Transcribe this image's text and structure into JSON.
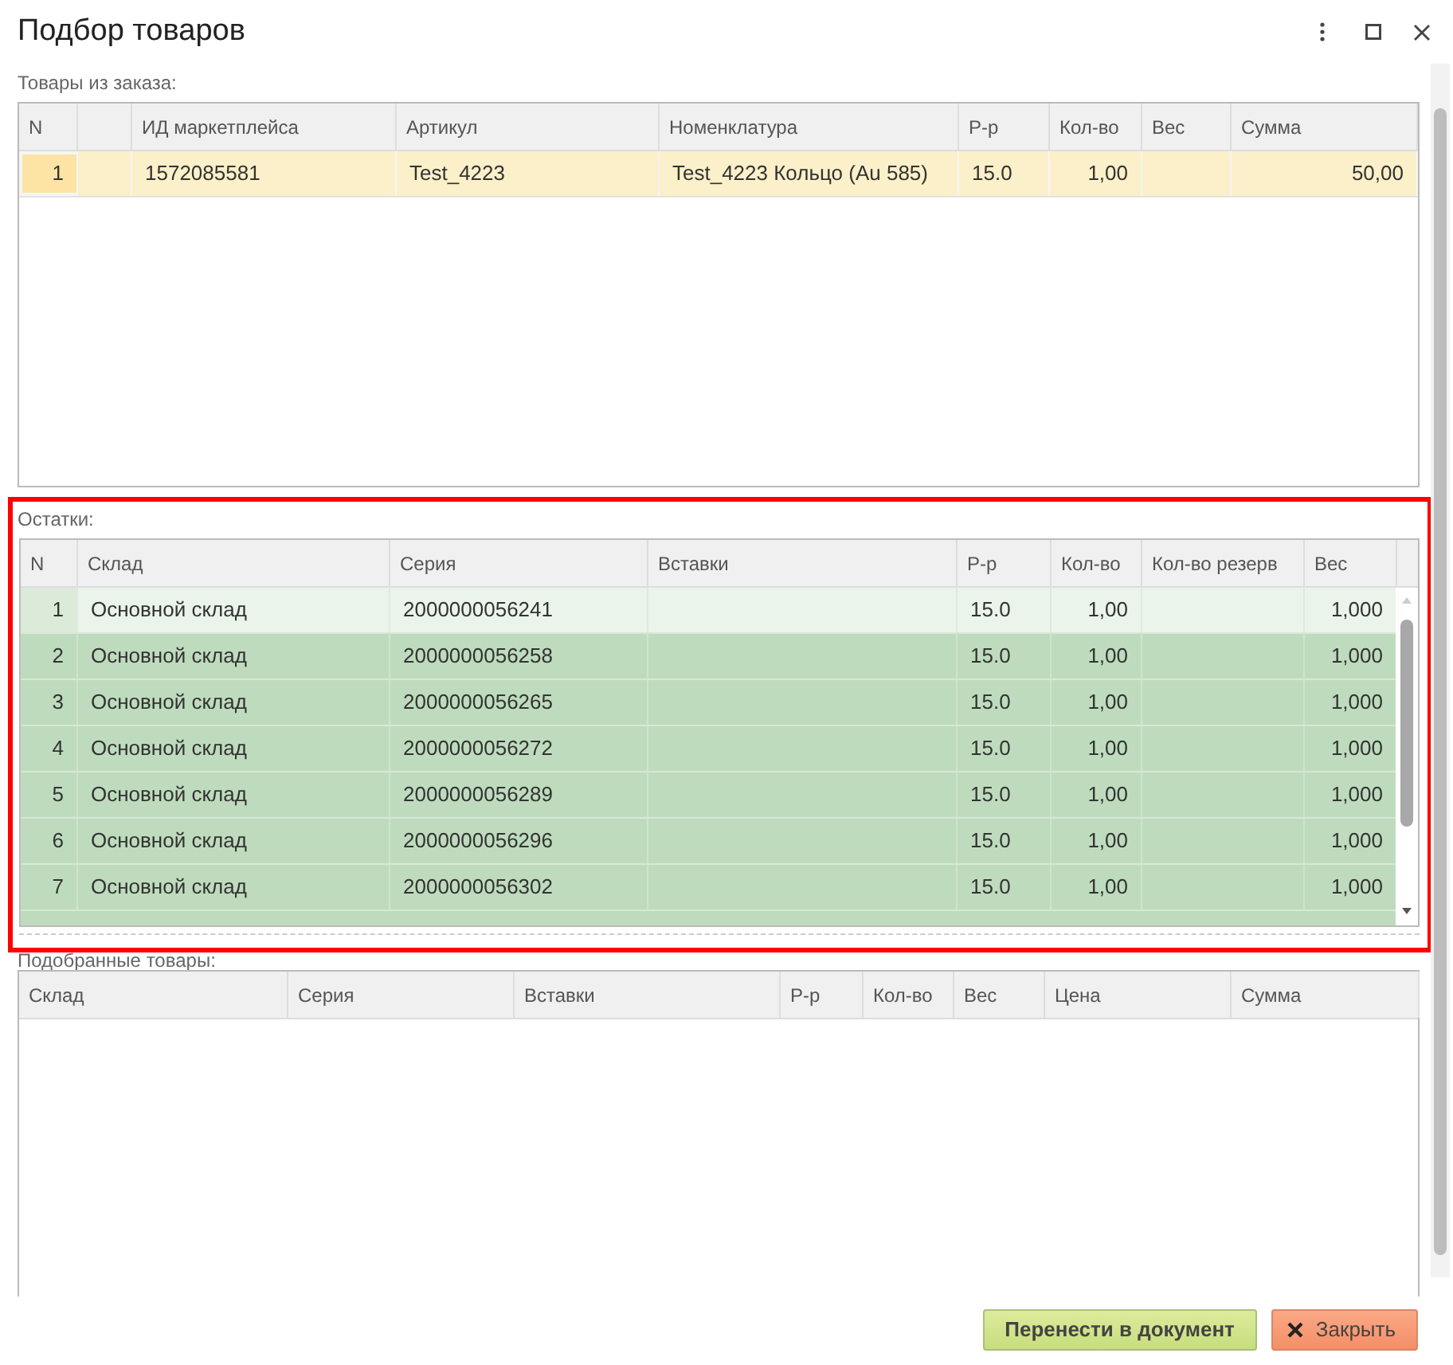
{
  "window": {
    "title": "Подбор товаров"
  },
  "order_items": {
    "label": "Товары из заказа:",
    "columns": [
      "N",
      "",
      "ИД маркетплейса",
      "Артикул",
      "Номенклатура",
      "Р-р",
      "Кол-во",
      "Вес",
      "Сумма"
    ],
    "rows": [
      {
        "selected": true,
        "cells": [
          "1",
          "",
          "1572085581",
          "Test_4223",
          "Test_4223 Кольцо (Au 585)",
          "15.0",
          "1,00",
          "",
          "50,00"
        ]
      }
    ]
  },
  "stock": {
    "label": "Остатки:",
    "columns": [
      "N",
      "Склад",
      "Серия",
      "Вставки",
      "Р-р",
      "Кол-во",
      "Кол-во резерв",
      "Вес"
    ],
    "rows": [
      {
        "selected": true,
        "cells": [
          "1",
          "Основной склад",
          "2000000056241",
          "",
          "15.0",
          "1,00",
          "",
          "1,000"
        ]
      },
      {
        "selected": false,
        "cells": [
          "2",
          "Основной склад",
          "2000000056258",
          "",
          "15.0",
          "1,00",
          "",
          "1,000"
        ]
      },
      {
        "selected": false,
        "cells": [
          "3",
          "Основной склад",
          "2000000056265",
          "",
          "15.0",
          "1,00",
          "",
          "1,000"
        ]
      },
      {
        "selected": false,
        "cells": [
          "4",
          "Основной склад",
          "2000000056272",
          "",
          "15.0",
          "1,00",
          "",
          "1,000"
        ]
      },
      {
        "selected": false,
        "cells": [
          "5",
          "Основной склад",
          "2000000056289",
          "",
          "15.0",
          "1,00",
          "",
          "1,000"
        ]
      },
      {
        "selected": false,
        "cells": [
          "6",
          "Основной склад",
          "2000000056296",
          "",
          "15.0",
          "1,00",
          "",
          "1,000"
        ]
      },
      {
        "selected": false,
        "cells": [
          "7",
          "Основной склад",
          "2000000056302",
          "",
          "15.0",
          "1,00",
          "",
          "1,000"
        ]
      }
    ]
  },
  "picked": {
    "label": "Подобранные товары:",
    "columns": [
      "Склад",
      "Серия",
      "Вставки",
      "Р-р",
      "Кол-во",
      "Вес",
      "Цена",
      "Сумма"
    ]
  },
  "buttons": [
    {
      "kind": "primary",
      "label": "Перенести в документ"
    },
    {
      "kind": "close",
      "label": "Закрыть"
    }
  ]
}
